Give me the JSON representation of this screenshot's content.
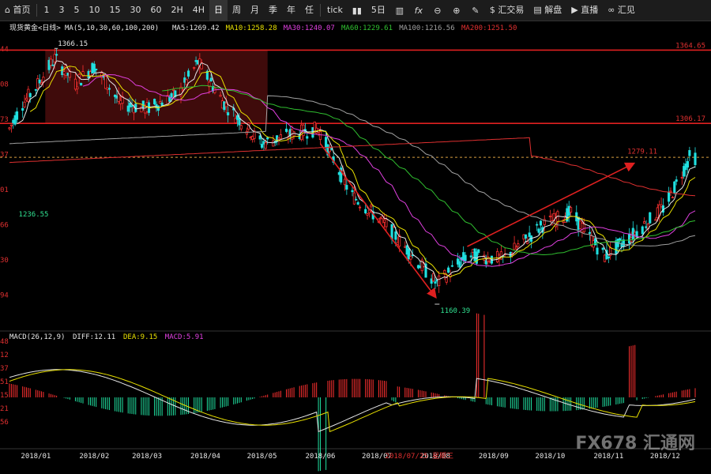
{
  "toolbar": {
    "home": "首页",
    "periods": [
      "1",
      "3",
      "5",
      "10",
      "15",
      "30",
      "60",
      "2H",
      "4H",
      "日",
      "周",
      "月",
      "季",
      "年",
      "任"
    ],
    "tick": "tick",
    "five_day": "5日",
    "fx_label": "汇交易",
    "analysis_label": "解盘",
    "live_label": "直播",
    "view_label": "汇见",
    "icons": [
      "home-icon",
      "bar-chart-icon",
      "candles-icon",
      "fx-icon",
      "zoom-out-icon",
      "zoom-in-icon",
      "pen-icon",
      "dollar-icon",
      "comment-icon",
      "play-icon",
      "link-icon"
    ]
  },
  "chart_data": {
    "type": "candlestick",
    "instrument": "现货黄金",
    "period": "<日线>",
    "ma_legend": {
      "prefix": "MA(5,10,30,60,100,200)",
      "items": [
        {
          "label": "MA5:1269.42",
          "color": "#e6e6e6"
        },
        {
          "label": "MA10:1258.28",
          "color": "#e8e000"
        },
        {
          "label": "MA30:1240.07",
          "color": "#e040e0"
        },
        {
          "label": "MA60:1229.61",
          "color": "#30c030"
        },
        {
          "label": "MA100:1216.56",
          "color": "#a0a0a0"
        },
        {
          "label": "MA200:1251.50",
          "color": "#e03030"
        }
      ]
    },
    "x_labels": [
      "2018/01",
      "2018/02",
      "2018/03",
      "2018/04",
      "2018/05",
      "2018/06",
      "2018/07",
      "2018/08",
      "2018/09",
      "2018/10",
      "2018/11",
      "2018/12"
    ],
    "date_marker": "2018/07/25 星期三",
    "y_tick_fragments": [
      "44",
      "08",
      "73",
      "37",
      "01",
      "66",
      "30",
      "94"
    ],
    "horizontal_levels": [
      {
        "value": 1364.65,
        "label": "1364.65"
      },
      {
        "value": 1306.17,
        "label": "1306.17"
      },
      {
        "value": 1279.11,
        "label": "1279.11",
        "dashed": true
      }
    ],
    "annotations": [
      {
        "label": "1366.15",
        "kind": "high"
      },
      {
        "label": "1236.55",
        "kind": "low"
      },
      {
        "label": "1160.39",
        "kind": "low"
      },
      {
        "label": "1279.11",
        "kind": "high"
      }
    ],
    "price_path": [
      {
        "date": "2018-01-01",
        "close": 1302
      },
      {
        "date": "2018-01-08",
        "close": 1322
      },
      {
        "date": "2018-01-15",
        "close": 1335
      },
      {
        "date": "2018-01-25",
        "close": 1358
      },
      {
        "date": "2018-02-05",
        "close": 1338
      },
      {
        "date": "2018-02-15",
        "close": 1352
      },
      {
        "date": "2018-03-01",
        "close": 1322
      },
      {
        "date": "2018-03-15",
        "close": 1318
      },
      {
        "date": "2018-04-01",
        "close": 1330
      },
      {
        "date": "2018-04-11",
        "close": 1355
      },
      {
        "date": "2018-04-25",
        "close": 1322
      },
      {
        "date": "2018-05-15",
        "close": 1290
      },
      {
        "date": "2018-06-01",
        "close": 1298
      },
      {
        "date": "2018-06-14",
        "close": 1302
      },
      {
        "date": "2018-07-01",
        "close": 1250
      },
      {
        "date": "2018-07-20",
        "close": 1225
      },
      {
        "date": "2018-08-16",
        "close": 1178
      },
      {
        "date": "2018-09-01",
        "close": 1201
      },
      {
        "date": "2018-09-20",
        "close": 1198
      },
      {
        "date": "2018-10-11",
        "close": 1225
      },
      {
        "date": "2018-10-26",
        "close": 1235
      },
      {
        "date": "2018-11-13",
        "close": 1200
      },
      {
        "date": "2018-11-30",
        "close": 1220
      },
      {
        "date": "2018-12-15",
        "close": 1240
      },
      {
        "date": "2018-12-28",
        "close": 1279
      }
    ],
    "macd": {
      "legend": "MACD(26,12,9)",
      "items": [
        {
          "label": "DIFF:12.11",
          "color": "#e6e6e6"
        },
        {
          "label": "DEA:9.15",
          "color": "#e8e000"
        },
        {
          "label": "MACD:5.91",
          "color": "#e040e0"
        }
      ],
      "y_tick_fragments": [
        "48",
        "12",
        "37",
        "51",
        "15",
        "21",
        "56"
      ]
    }
  },
  "watermark": "FX678 汇通网"
}
